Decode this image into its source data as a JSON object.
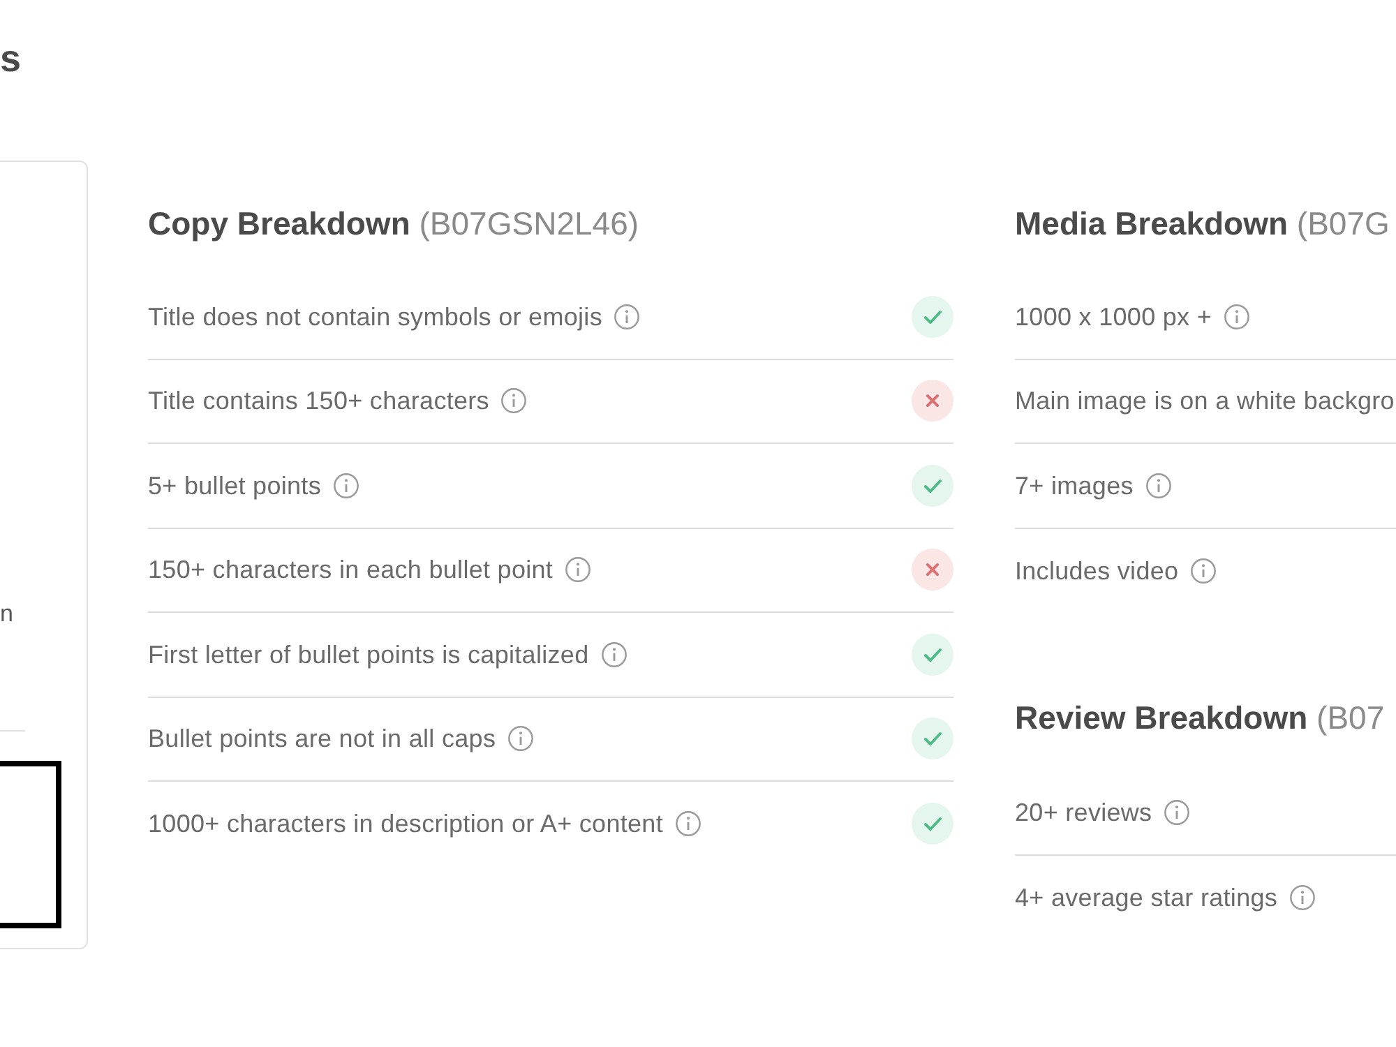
{
  "page_heading": "s",
  "side_card": {
    "text": "n"
  },
  "copy_breakdown": {
    "title": "**Copy Breakdown** (B07GSN2L46)",
    "rows": [
      {
        "label": "Title does not contain symbols or emojis",
        "info": true,
        "passed": true
      },
      {
        "label": "Title contains 150+ characters",
        "info": true,
        "passed": false
      },
      {
        "label": "5+ bullet points",
        "info": true,
        "passed": true
      },
      {
        "label": "150+ characters in each bullet point",
        "info": true,
        "passed": false
      },
      {
        "label": "First letter of bullet points is capitalized",
        "info": true,
        "passed": true
      },
      {
        "label": "Bullet points are not in all caps",
        "info": true,
        "passed": true
      },
      {
        "label": "1000+ characters in description or A+ content",
        "info": true,
        "passed": true
      }
    ]
  },
  "media_breakdown": {
    "title": "**Media Breakdown** (B07G",
    "rows": [
      {
        "label": "1000 x 1000 px +",
        "info": true
      },
      {
        "label": "Main image is on a white backgro",
        "info": false
      },
      {
        "label": "7+ images",
        "info": true
      },
      {
        "label": "Includes video",
        "info": true
      }
    ]
  },
  "review_breakdown": {
    "title": "**Review Breakdown** (B07",
    "rows": [
      {
        "label": "20+ reviews",
        "info": true
      },
      {
        "label": "4+ average star ratings",
        "info": true
      }
    ]
  }
}
